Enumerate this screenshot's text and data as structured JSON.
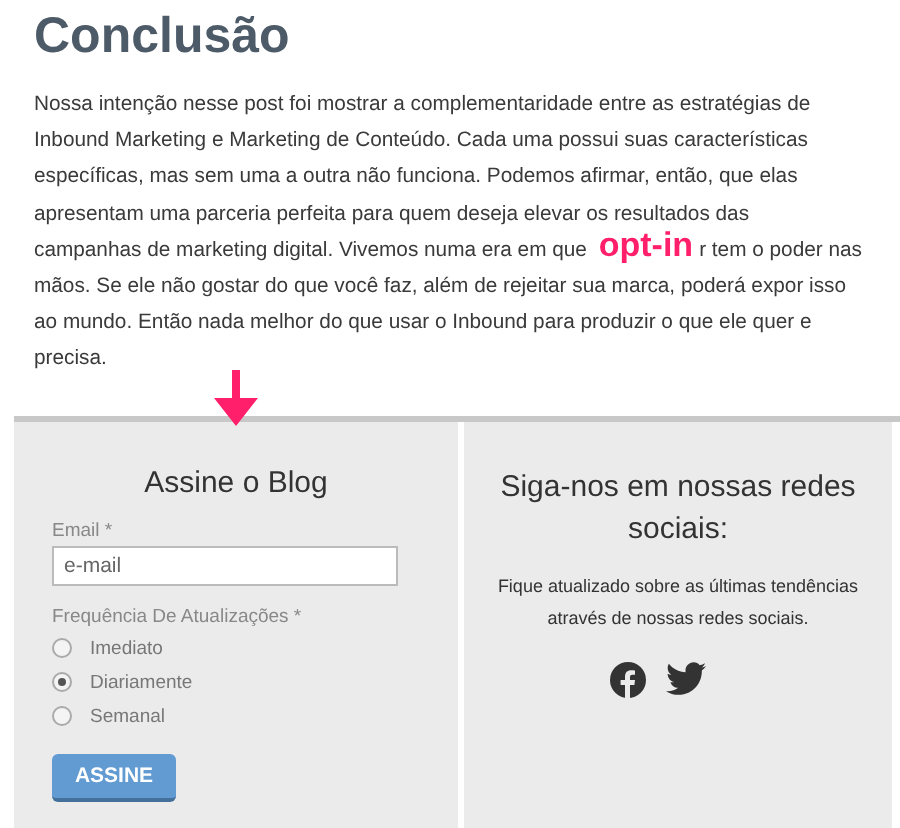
{
  "title": "Conclusão",
  "paragraph_start": "Nossa intenção nesse post foi mostrar a complementaridade entre as estratégias de Inbound Marketing e Marketing de Conteúdo. Cada uma possui suas características específicas, mas sem uma a outra não funciona. Podemos afirmar, então, que elas apresentam uma parceria perfeita para quem deseja elevar os resultados das campanhas de marketing digital. Vivemos numa era em que",
  "annotation": "opt-in",
  "paragraph_end": "r tem o poder nas mãos. Se ele não gostar do que você faz, além de rejeitar sua marca, poderá expor isso ao mundo. Então nada melhor do que usar o Inbound para produzir o que ele quer e precisa.",
  "subscribe": {
    "title": "Assine o Blog",
    "email_label": "Email *",
    "email_placeholder": "e-mail",
    "frequency_label": "Frequência De Atualizações *",
    "options": [
      {
        "label": "Imediato",
        "selected": false
      },
      {
        "label": "Diariamente",
        "selected": true
      },
      {
        "label": "Semanal",
        "selected": false
      }
    ],
    "button": "ASSINE"
  },
  "social": {
    "title": "Siga-nos em nossas redes sociais:",
    "text": "Fique atualizado sobre as últimas tendências através de nossas redes sociais.",
    "icons": [
      {
        "kind": "facebook"
      },
      {
        "kind": "twitter"
      }
    ]
  }
}
